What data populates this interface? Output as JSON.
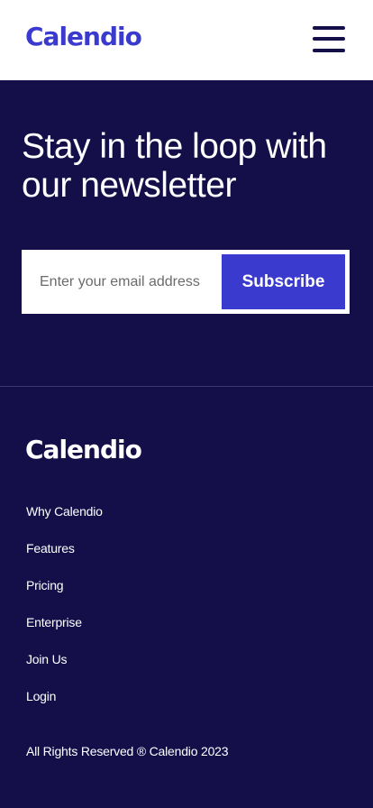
{
  "header": {
    "logo": "Calendio",
    "menu_icon": "hamburger-menu-icon"
  },
  "newsletter": {
    "title": "Stay in the loop with our newsletter",
    "email_placeholder": "Enter your email address",
    "email_value": "",
    "subscribe_label": "Subscribe"
  },
  "footer": {
    "logo": "Calendio",
    "links": [
      {
        "label": "Why Calendio"
      },
      {
        "label": "Features"
      },
      {
        "label": "Pricing"
      },
      {
        "label": "Enterprise"
      },
      {
        "label": "Join Us"
      },
      {
        "label": "Login"
      }
    ],
    "copyright": "All Rights Reserved ® Calendio 2023"
  },
  "colors": {
    "brand": "#3b3ace",
    "background_dark": "#140f49",
    "header_bg": "#ffffff"
  }
}
